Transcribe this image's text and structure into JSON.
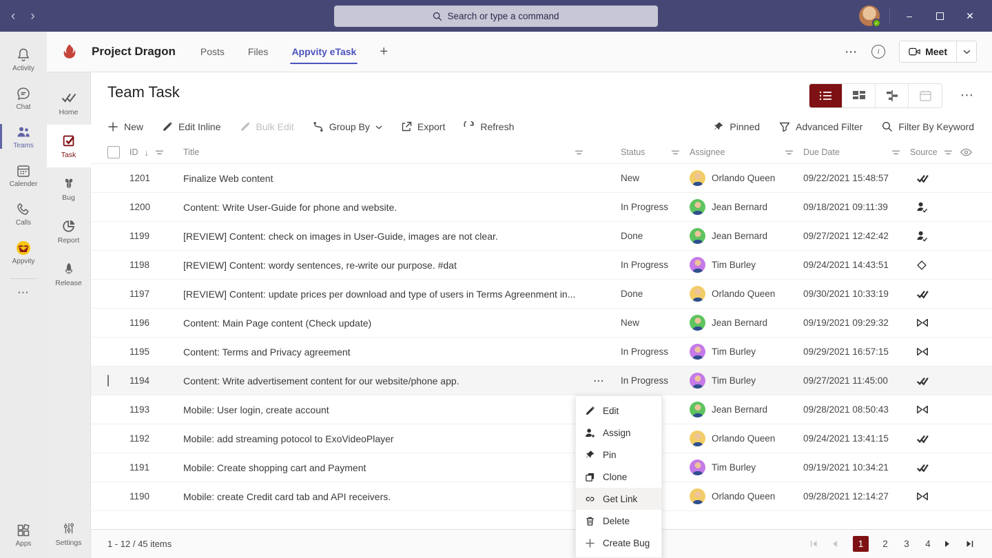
{
  "topbar": {
    "search_placeholder": "Search or type a command"
  },
  "app_rail": {
    "items": [
      {
        "label": "Activity",
        "icon": "bell-icon",
        "active": false
      },
      {
        "label": "Chat",
        "icon": "chat-icon",
        "active": false
      },
      {
        "label": "Teams",
        "icon": "teams-icon",
        "active": true
      },
      {
        "label": "Calender",
        "icon": "calendar-icon",
        "active": false
      },
      {
        "label": "Calls",
        "icon": "phone-icon",
        "active": false
      },
      {
        "label": "Appvity",
        "icon": "appvity-logo-icon",
        "active": false
      }
    ],
    "apps_label": "Apps",
    "settings_label": "Settings"
  },
  "sub_rail": {
    "items": [
      {
        "label": "Home",
        "icon": "home-icon",
        "active": false
      },
      {
        "label": "Task",
        "icon": "task-icon",
        "active": true
      },
      {
        "label": "Bug",
        "icon": "bug-icon",
        "active": false
      },
      {
        "label": "Report",
        "icon": "report-icon",
        "active": false
      },
      {
        "label": "Release",
        "icon": "release-icon",
        "active": false
      }
    ]
  },
  "channel_header": {
    "team_name": "Project Dragon",
    "tabs": [
      {
        "label": "Posts",
        "active": false
      },
      {
        "label": "Files",
        "active": false
      },
      {
        "label": "Appvity eTask",
        "active": true
      }
    ],
    "add_tab": "+",
    "meet_label": "Meet"
  },
  "page": {
    "title": "Team Task"
  },
  "toolbar": {
    "new": "New",
    "edit_inline": "Edit Inline",
    "bulk_edit": "Bulk Edit",
    "group_by": "Group By",
    "export": "Export",
    "refresh": "Refresh",
    "pinned": "Pinned",
    "advanced_filter": "Advanced Filter",
    "filter_by_keyword": "Filter By Keyword"
  },
  "table": {
    "headers": {
      "id": "ID",
      "title": "Title",
      "status": "Status",
      "assignee": "Assignee",
      "due_date": "Due Date",
      "source": "Source"
    },
    "rows": [
      {
        "id": "1201",
        "title": "Finalize Web content",
        "status": "New",
        "assignee": "Orlando Queen",
        "avatar": "yellow",
        "due": "09/22/2021 15:48:57",
        "source": "planner",
        "selected": "false"
      },
      {
        "id": "1200",
        "title": "Content: Write User-Guide for phone and website.",
        "status": "In Progress",
        "assignee": "Jean Bernard",
        "avatar": "green",
        "due": "09/18/2021 09:11:39",
        "source": "user-check",
        "selected": "false"
      },
      {
        "id": "1199",
        "title": "[REVIEW] Content: check on images in User-Guide, images are not clear.",
        "status": "Done",
        "assignee": "Jean Bernard",
        "avatar": "green",
        "due": "09/27/2021 12:42:42",
        "source": "user-check",
        "selected": "false"
      },
      {
        "id": "1198",
        "title": "[REVIEW] Content: wordy sentences, re-write our purpose. #dat",
        "status": "In Progress",
        "assignee": "Tim Burley",
        "avatar": "purple",
        "due": "09/24/2021 14:43:51",
        "source": "diamond",
        "selected": "false"
      },
      {
        "id": "1197",
        "title": "[REVIEW] Content: update prices per download and type of users in Terms Agreenment in...",
        "status": "Done",
        "assignee": "Orlando Queen",
        "avatar": "yellow",
        "due": "09/30/2021 10:33:19",
        "source": "planner",
        "selected": "false"
      },
      {
        "id": "1196",
        "title": "Content: Main Page content (Check update)",
        "status": "New",
        "assignee": "Jean Bernard",
        "avatar": "green",
        "due": "09/19/2021 09:29:32",
        "source": "bowtie",
        "selected": "false"
      },
      {
        "id": "1195",
        "title": "Content: Terms and Privacy agreement",
        "status": "In Progress",
        "assignee": "Tim Burley",
        "avatar": "purple",
        "due": "09/29/2021 16:57:15",
        "source": "bowtie",
        "selected": "false"
      },
      {
        "id": "1194",
        "title": "Content: Write advertisement content for our website/phone app.",
        "status": "In Progress",
        "assignee": "Tim Burley",
        "avatar": "purple",
        "due": "09/27/2021 11:45:00",
        "source": "planner",
        "selected": "true"
      },
      {
        "id": "1193",
        "title": "Mobile: User login, create account",
        "status": "",
        "assignee": "Jean Bernard",
        "avatar": "green",
        "due": "09/28/2021 08:50:43",
        "source": "bowtie",
        "selected": "false"
      },
      {
        "id": "1192",
        "title": "Mobile: add streaming potocol to ExoVideoPlayer",
        "status": "",
        "assignee": "Orlando Queen",
        "avatar": "yellow",
        "due": "09/24/2021 13:41:15",
        "source": "planner",
        "selected": "false"
      },
      {
        "id": "1191",
        "title": "Mobile: Create shopping cart and Payment",
        "status": "",
        "assignee": "Tim Burley",
        "avatar": "purple",
        "due": "09/19/2021 10:34:21",
        "source": "planner",
        "selected": "false"
      },
      {
        "id": "1190",
        "title": "Mobile: create Credit card tab and API receivers.",
        "status": "",
        "assignee": "Orlando Queen",
        "avatar": "yellow",
        "due": "09/28/2021 12:14:27",
        "source": "bowtie",
        "selected": "false"
      }
    ]
  },
  "context_menu": {
    "items": [
      {
        "label": "Edit",
        "icon": "pencil-icon"
      },
      {
        "label": "Assign",
        "icon": "person-add-icon"
      },
      {
        "label": "Pin",
        "icon": "pin-icon"
      },
      {
        "label": "Clone",
        "icon": "clone-icon"
      },
      {
        "label": "Get Link",
        "icon": "link-icon"
      },
      {
        "label": "Delete",
        "icon": "trash-icon"
      },
      {
        "label": "Create Bug",
        "icon": "plus-icon"
      }
    ],
    "highlighted": "Get Link"
  },
  "footer": {
    "page_info": "1 - 12 / 45 items",
    "pages": [
      "1",
      "2",
      "3",
      "4"
    ],
    "current_page": "1"
  },
  "icons": {
    "ellipsis_glyph": "⋯",
    "sort_desc_glyph": "↓",
    "back_glyph": "‹",
    "forward_glyph": "›",
    "minimize_glyph": "–",
    "close_glyph": "✕",
    "check_glyph": "✔",
    "add_glyph": "+"
  },
  "colors": {
    "accent": "#7e1113",
    "teams_bar": "#464775",
    "teams_active": "#6264a7",
    "tab_accent": "#4b53bc",
    "presence_green": "#6bb700",
    "logo_red": "#c5443c",
    "appvity_yellow": "#f8c513",
    "avatar_yellow": "#f2cd67",
    "avatar_green": "#5ec45e",
    "avatar_purple": "#c47ae8"
  }
}
